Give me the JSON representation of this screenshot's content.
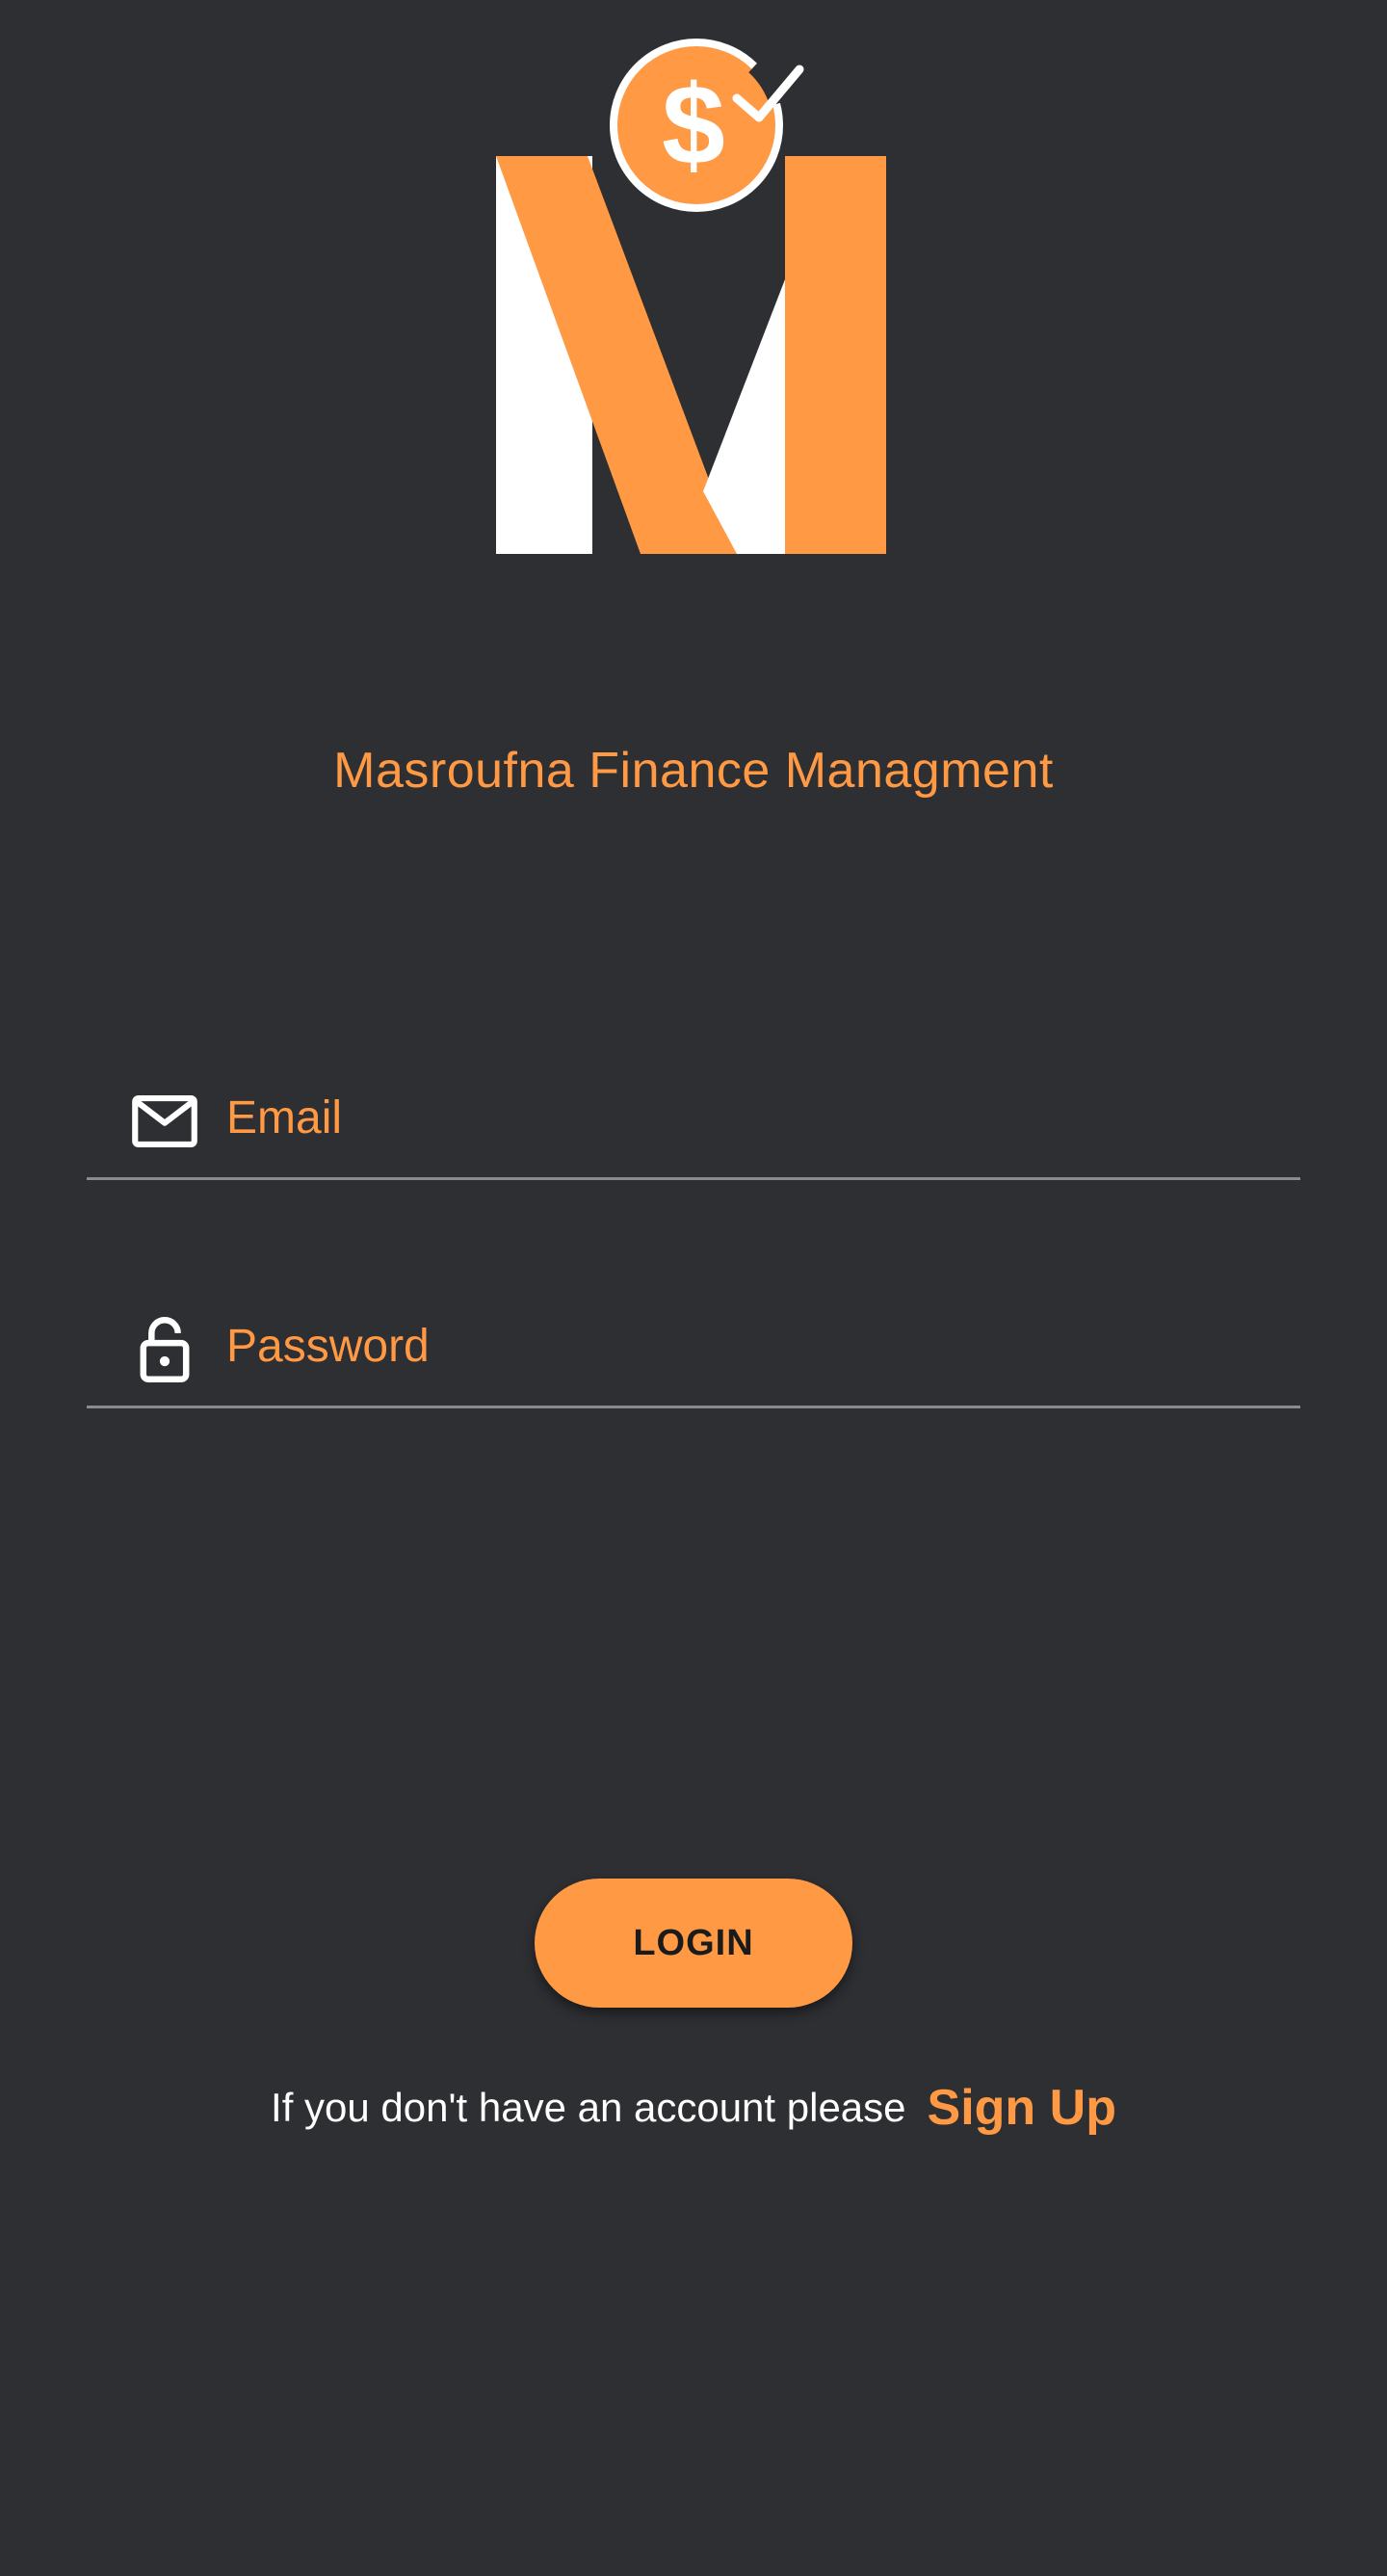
{
  "app": {
    "title": "Masroufna Finance Managment"
  },
  "form": {
    "email": {
      "value": "",
      "placeholder": "Email",
      "icon": "mail-icon"
    },
    "password": {
      "value": "",
      "placeholder": "Password",
      "icon": "lock-icon"
    }
  },
  "actions": {
    "login_label": "LOGIN",
    "signup_prompt": "If you don't have an account please",
    "signup_label": "Sign Up"
  },
  "colors": {
    "background": "#2e2f33",
    "accent": "#ff9944",
    "text": "#ffffff",
    "divider": "#8a8b8f"
  }
}
